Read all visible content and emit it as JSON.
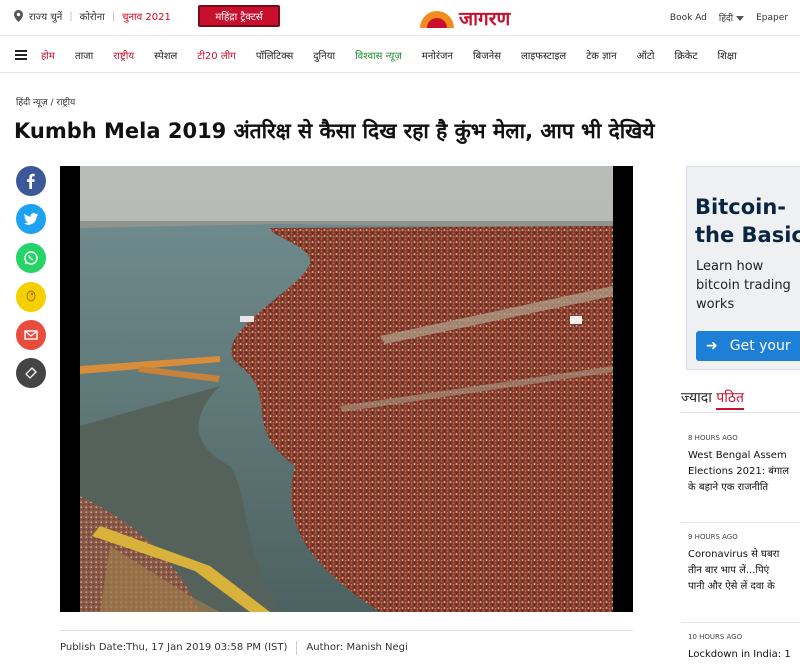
{
  "topbar": {
    "state_select": "राज्य चुनें",
    "corona": "कोरोना",
    "elections": "चुनाव 2021",
    "sponsor": "महिंद्रा ट्रैक्टर्स",
    "logo": "जागरण",
    "book_ad": "Book Ad",
    "language": "हिंदी",
    "epaper": "Epaper"
  },
  "nav": {
    "items": [
      "होम",
      "ताजा",
      "राष्ट्रीय",
      "स्पेशल",
      "टी20 लीग",
      "पॉलिटिक्स",
      "दुनिया",
      "विश्वास न्यूज़",
      "मनोरंजन",
      "बिजनेस",
      "लाइफस्टाइल",
      "टेक ज्ञान",
      "ऑटो",
      "क्रिकेट",
      "शिक्षा"
    ]
  },
  "breadcrumb": "हिंदी न्यूज़ / राष्ट्रीय",
  "article": {
    "title": "Kumbh Mela 2019 अंतरिक्ष से कैसा दिख रहा है कुंभ मेला, आप भी देखिये",
    "publish_date": "Publish Date:Thu, 17 Jan 2019 03:58 PM (IST)",
    "author": "Author: Manish Negi"
  },
  "share": [
    {
      "icon": "facebook-icon",
      "color": "#3b5998"
    },
    {
      "icon": "twitter-icon",
      "color": "#1da1f2"
    },
    {
      "icon": "whatsapp-icon",
      "color": "#25d366"
    },
    {
      "icon": "koo-icon",
      "color": "#f5d000"
    },
    {
      "icon": "email-icon",
      "color": "#e74c3c"
    },
    {
      "icon": "link-icon",
      "color": "#444444"
    }
  ],
  "ad": {
    "headline_1": "Bitcoin-",
    "headline_2": "the Basics",
    "sub_1": "Learn how",
    "sub_2": "bitcoin trading",
    "sub_3": "works",
    "button": "Get your"
  },
  "most_read": {
    "label_1": "ज्यादा",
    "label_2": "पठित",
    "stories": [
      {
        "time": "8 HOURS AGO",
        "line1": "West Bengal Assem",
        "line2": "Elections 2021: बंगाल",
        "line3": "के बहाने एक राजनीति"
      },
      {
        "time": "9 HOURS AGO",
        "line1": "Coronavirus से घबरा",
        "line2": "तीन बार भाप लें...पिएं",
        "line3": "पानी और ऐसे लें दवा के"
      },
      {
        "time": "10 HOURS AGO",
        "line1": "Lockdown in India: 1",
        "line2": "",
        "line3": ""
      }
    ]
  },
  "colors": {
    "brand": "#c8102e",
    "green": "#1a8c2e"
  }
}
